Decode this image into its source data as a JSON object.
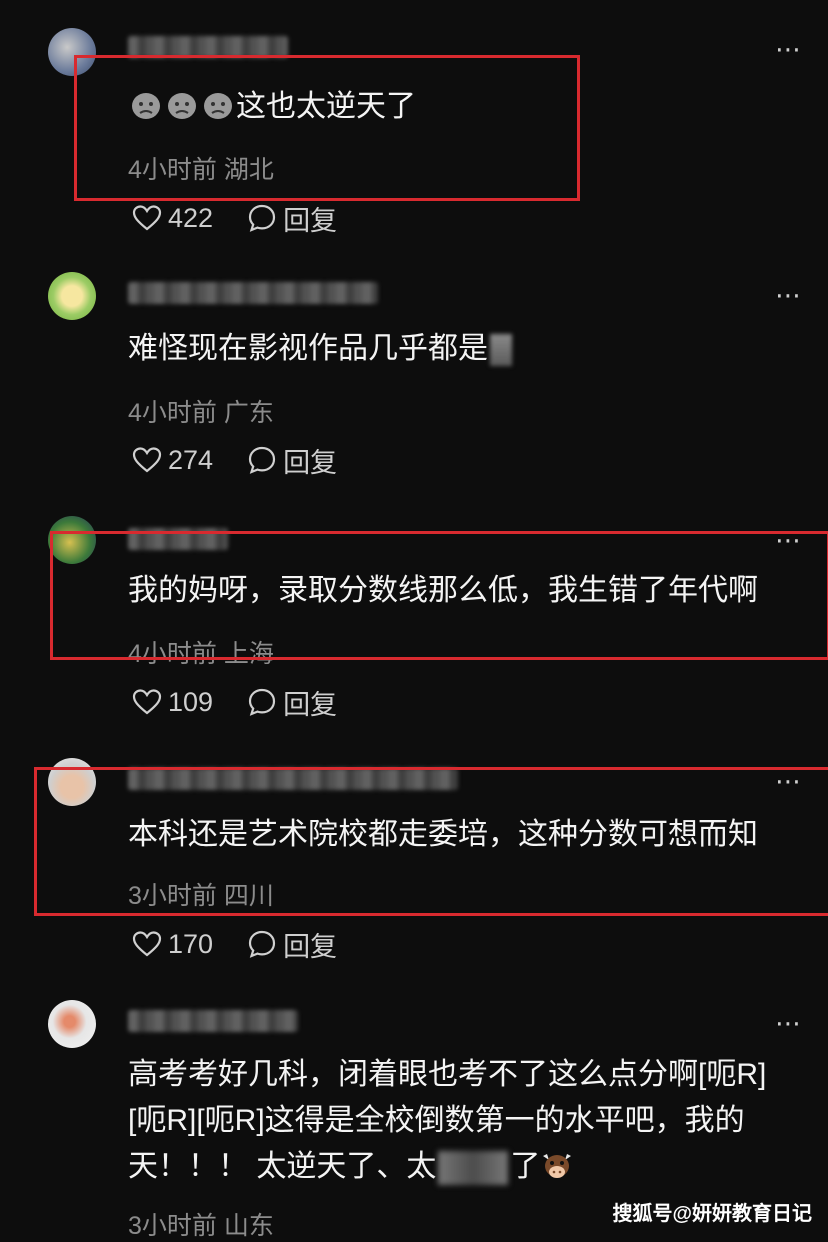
{
  "comments": [
    {
      "text": "这也太逆天了",
      "time": "4小时前",
      "location": "湖北",
      "likes": "422",
      "reply": "回复"
    },
    {
      "text": "难怪现在影视作品几乎都是",
      "time": "4小时前",
      "location": "广东",
      "likes": "274",
      "reply": "回复"
    },
    {
      "text": "我的妈呀，录取分数线那么低，我生错了年代啊",
      "time": "4小时前",
      "location": "上海",
      "likes": "109",
      "reply": "回复"
    },
    {
      "text": "本科还是艺术院校都走委培，这种分数可想而知",
      "time": "3小时前",
      "location": "四川",
      "likes": "170",
      "reply": "回复"
    },
    {
      "text_line1": "高考考好几科，闭着眼也考不了这么点分啊[呃R]",
      "text_line2": "[呃R][呃R]这得是全校倒数第一的水平吧，我的",
      "text_line3_a": "天！！！ 太逆天了、太",
      "text_line3_b": "了",
      "time": "3小时前",
      "location": "山东"
    }
  ],
  "more_icon": "⋯",
  "watermark": "搜狐号@妍妍教育日记",
  "colors": {
    "highlight": "#d82a2f",
    "background": "#0d0d0d"
  }
}
